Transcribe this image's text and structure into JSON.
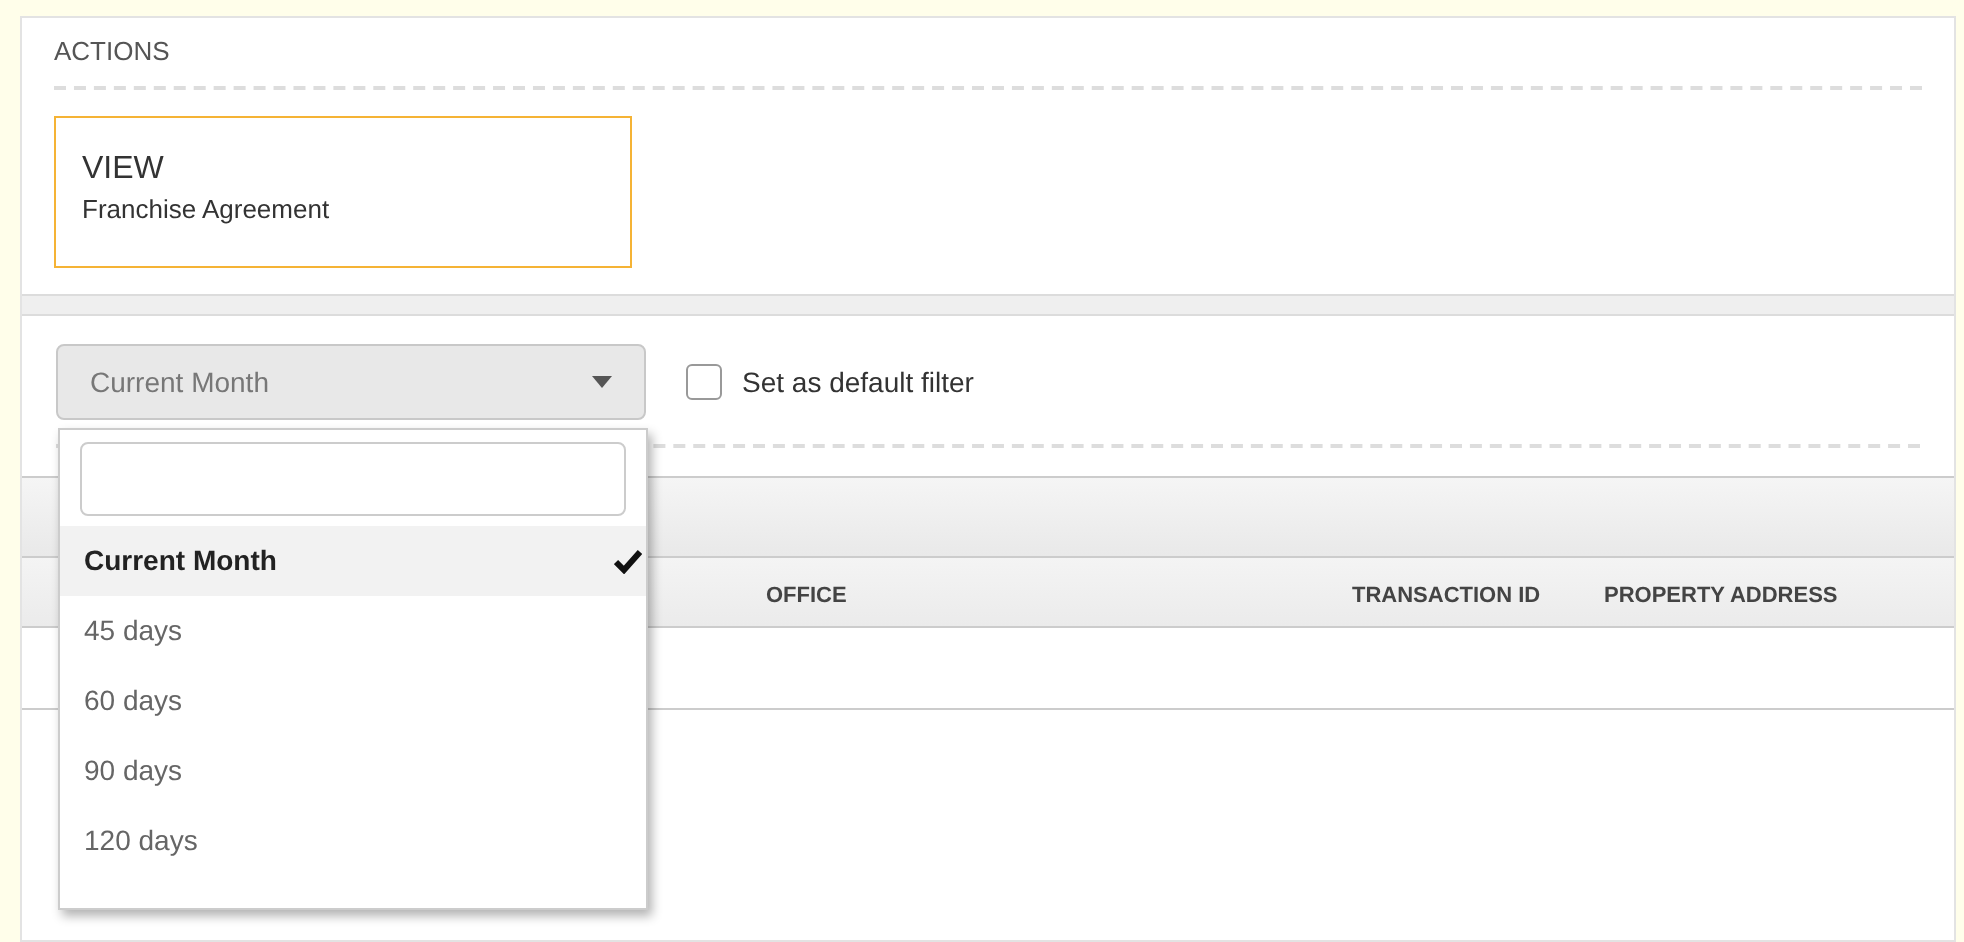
{
  "actions": {
    "heading": "ACTIONS",
    "cards": [
      {
        "title": "VIEW",
        "subtitle": "Franchise Agreement"
      }
    ]
  },
  "filter": {
    "select": {
      "value": "Current Month",
      "expanded": true
    },
    "default_filter": {
      "label": "Set as default filter",
      "checked": false
    }
  },
  "dropdown": {
    "options": [
      {
        "label": "Current Month",
        "selected": true
      },
      {
        "label": "45 days",
        "selected": false
      },
      {
        "label": "60 days",
        "selected": false
      },
      {
        "label": "90 days",
        "selected": false
      },
      {
        "label": "120 days",
        "selected": false
      }
    ]
  },
  "table": {
    "columns": [
      "OFFICE",
      "TRANSACTION ID",
      "PROPERTY ADDRESS"
    ]
  }
}
